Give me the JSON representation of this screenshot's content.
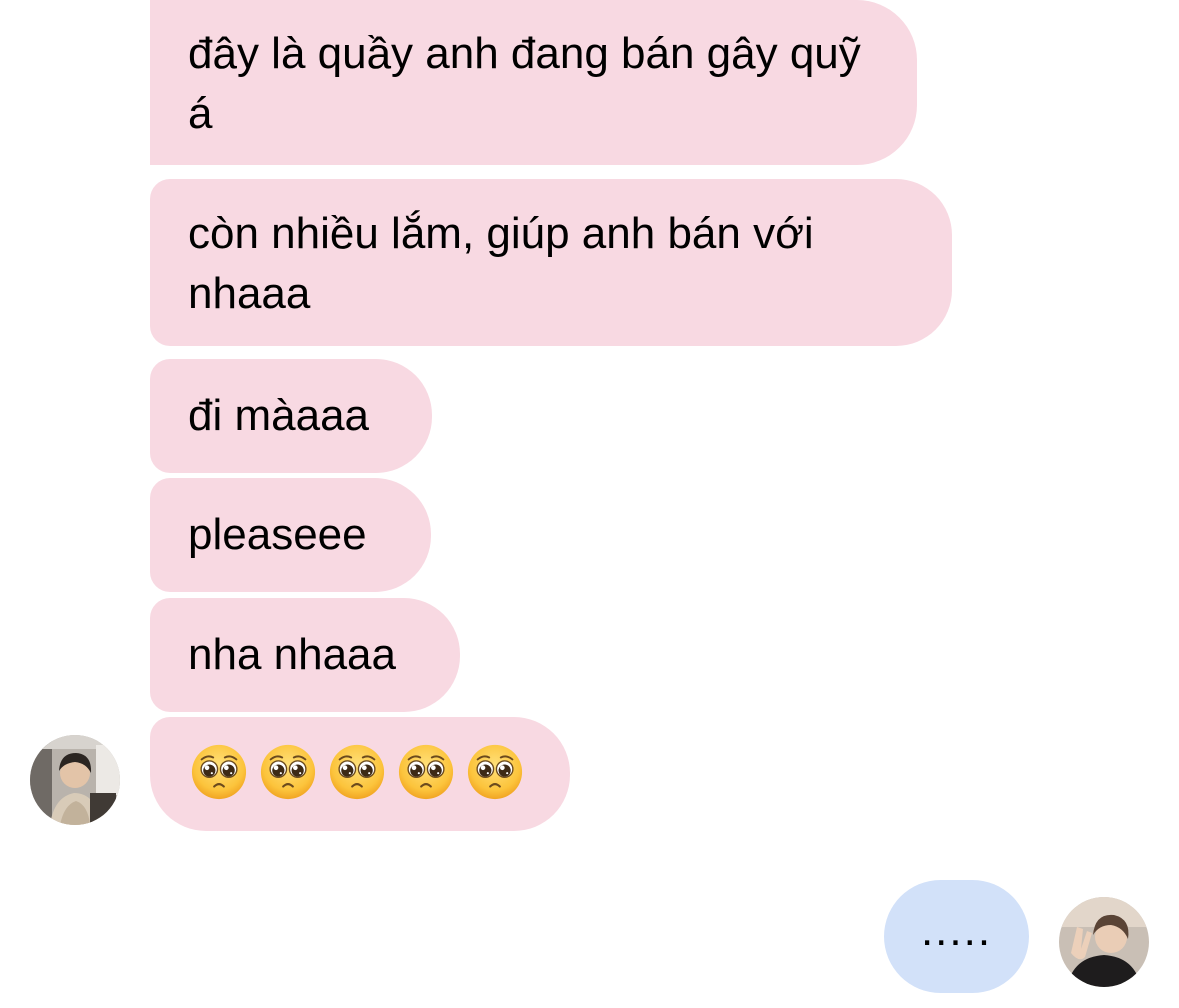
{
  "conversation": {
    "received": [
      {
        "text": "đây là quầy anh đang bán gây quỹ á"
      },
      {
        "text": "còn nhiều lắm, giúp anh bán với nhaaa"
      },
      {
        "text": "đi màaaa"
      },
      {
        "text": "pleaseee"
      },
      {
        "text": "nha nhaaa"
      },
      {
        "emoji": [
          "pleading-face",
          "pleading-face",
          "pleading-face",
          "pleading-face",
          "pleading-face"
        ]
      }
    ],
    "sent": [
      {
        "text": "....."
      }
    ]
  },
  "colors": {
    "received_bubble": "#f8d9e2",
    "sent_bubble": "#d2e1f9",
    "background": "#ffffff",
    "text": "#000000"
  },
  "avatars": {
    "left": "contact-avatar",
    "right": "user-avatar"
  }
}
